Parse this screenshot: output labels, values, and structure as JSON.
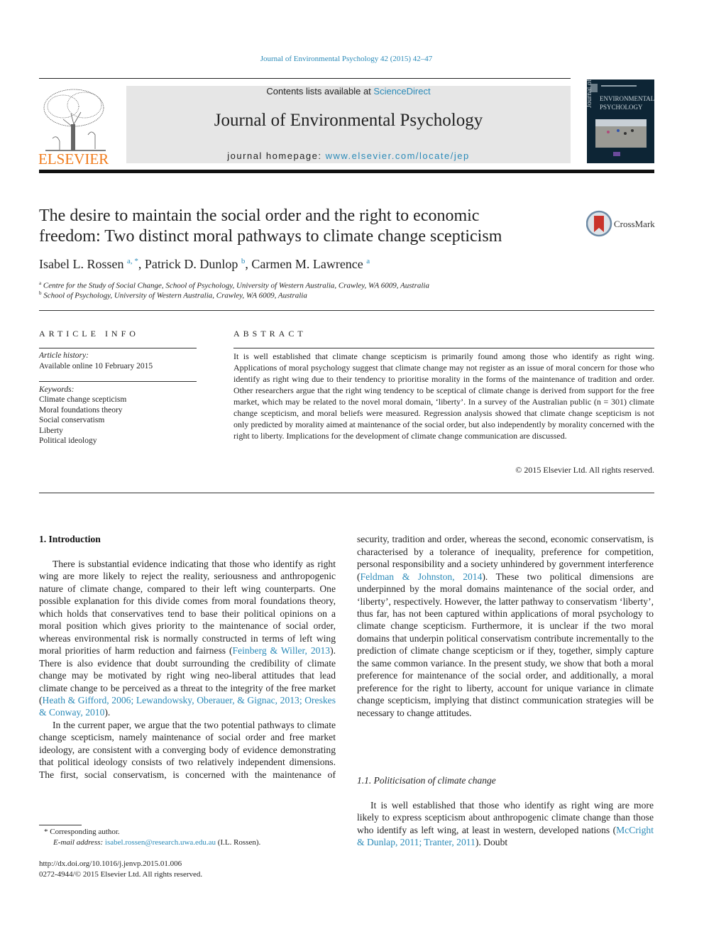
{
  "header": {
    "running_head": "Journal of Environmental Psychology 42 (2015) 42–47",
    "publisher_logo_label": "ELSEVIER",
    "contents_prefix": "Contents lists available at ",
    "contents_link": "ScienceDirect",
    "journal_title": "Journal of Environmental Psychology",
    "homepage_prefix": "journal homepage: ",
    "homepage_link": "www.elsevier.com/locate/jep",
    "colors": {
      "link": "#2a8ab8",
      "elsevier_orange": "#f07a1a",
      "banner_bg": "#e6e6e6",
      "cover_bg": "#0d2535"
    }
  },
  "article": {
    "title_line1": "The desire to maintain the social order and the right to economic",
    "title_line2": "freedom: Two distinct moral pathways to climate change scepticism",
    "crossmark_label": "CrossMark",
    "authors": [
      {
        "name": "Isabel L. Rossen",
        "sup": "a, *"
      },
      {
        "name": "Patrick D. Dunlop",
        "sup": "b"
      },
      {
        "name": "Carmen M. Lawrence",
        "sup": "a"
      }
    ],
    "affiliations": [
      {
        "key": "a",
        "text": "Centre for the Study of Social Change, School of Psychology, University of Western Australia, Crawley, WA 6009, Australia"
      },
      {
        "key": "b",
        "text": "School of Psychology, University of Western Australia, Crawley, WA 6009, Australia"
      }
    ]
  },
  "article_info": {
    "heading": "ARTICLE INFO",
    "history_label": "Article history:",
    "history_value": "Available online 10 February 2015",
    "keywords_label": "Keywords:",
    "keywords": [
      "Climate change scepticism",
      "Moral foundations theory",
      "Social conservatism",
      "Liberty",
      "Political ideology"
    ]
  },
  "abstract": {
    "heading": "ABSTRACT",
    "text": "It is well established that climate change scepticism is primarily found among those who identify as right wing. Applications of moral psychology suggest that climate change may not register as an issue of moral concern for those who identify as right wing due to their tendency to prioritise morality in the forms of the maintenance of tradition and order. Other researchers argue that the right wing tendency to be sceptical of climate change is derived from support for the free market, which may be related to the novel moral domain, ‘liberty’. In a survey of the Australian public (n = 301) climate change scepticism, and moral beliefs were measured. Regression analysis showed that climate change scepticism is not only predicted by morality aimed at maintenance of the social order, but also independently by morality concerned with the right to liberty. Implications for the development of climate change communication are discussed.",
    "copyright": "© 2015 Elsevier Ltd. All rights reserved."
  },
  "body": {
    "section1_heading": "1.  Introduction",
    "p1_a": "There is substantial evidence indicating that those who identify as right wing are more likely to reject the reality, seriousness and anthropogenic nature of climate change, compared to their left wing counterparts. One possible explanation for this divide comes from moral foundations theory, which holds that conservatives tend to base their political opinions on a moral position which gives priority to the maintenance of social order, whereas environmental risk is normally constructed in terms of left wing moral priorities of harm reduction and fairness (",
    "p1_cite1": "Feinberg & Willer, 2013",
    "p1_b": "). There is also evidence that doubt surrounding the credibility of climate change may be motivated by right wing neo-liberal attitudes that lead climate change to be perceived as a threat to the integrity of the free market (",
    "p1_cite2": "Heath & Gifford, 2006; Lewandowsky, Oberauer, & Gignac, 2013; Oreskes & Conway, 2010",
    "p1_c": ").",
    "p2_a": "In the current paper, we argue that the two potential pathways to climate change scepticism, namely maintenance of social order and free market ideology, are consistent with a converging body of evidence demonstrating that political ideology consists of two relatively independent dimensions. The first, social conservatism, is concerned with the maintenance of security, tradition and order, whereas the second, economic conservatism, is characterised by a tolerance of inequality, preference for competition, personal responsibility and a society unhindered by government interference (",
    "p2_cite": "Feldman & Johnston, 2014",
    "p2_b": "). These two political dimensions are underpinned by the moral domains maintenance of the social order, and ‘liberty’, respectively. However, the latter pathway to conservatism ‘liberty’, thus far, has not been captured within applications of moral psychology to climate change scepticism. Furthermore, it is unclear if the two moral domains that underpin political conservatism contribute incrementally to the prediction of climate change scepticism or if they, together, simply capture the same common variance. In the present study, we show that both a moral preference for maintenance of the social order, and additionally, a moral preference for the right to liberty, account for unique variance in climate change scepticism, implying that distinct communication strategies will be necessary to change attitudes.",
    "section1_1_heading": "1.1.  Politicisation of climate change",
    "p3_a": "It is well established that those who identify as right wing are more likely to express scepticism about anthropogenic climate change than those who identify as left wing, at least in western, developed nations (",
    "p3_cite": "McCright & Dunlap, 2011; Tranter, 2011",
    "p3_b": "). Doubt"
  },
  "footer": {
    "corresponding": "* Corresponding author.",
    "email_label": "E-mail address: ",
    "email": "isabel.rossen@research.uwa.edu.au",
    "email_suffix": " (I.L. Rossen).",
    "doi": "http://dx.doi.org/10.1016/j.jenvp.2015.01.006",
    "issn_line": "0272-4944/© 2015 Elsevier Ltd. All rights reserved."
  }
}
